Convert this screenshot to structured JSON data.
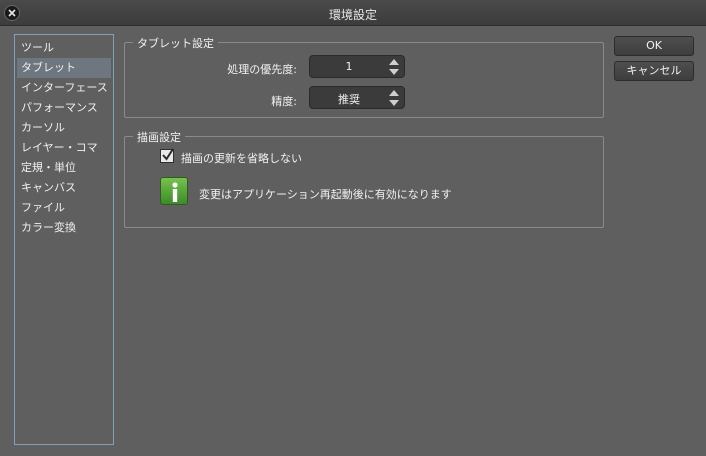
{
  "window": {
    "title": "環境設定"
  },
  "sidebar": {
    "items": [
      {
        "label": "ツール"
      },
      {
        "label": "タブレット",
        "selected": true
      },
      {
        "label": "インターフェース"
      },
      {
        "label": "パフォーマンス"
      },
      {
        "label": "カーソル"
      },
      {
        "label": "レイヤー・コマ"
      },
      {
        "label": "定規・単位"
      },
      {
        "label": "キャンバス"
      },
      {
        "label": "ファイル"
      },
      {
        "label": "カラー変換"
      }
    ]
  },
  "tablet_group": {
    "title": "タブレット設定",
    "processing_priority": {
      "label": "処理の優先度:",
      "value": "1"
    },
    "precision": {
      "label": "精度:",
      "value": "推奨"
    }
  },
  "drawing_group": {
    "title": "描画設定",
    "skip_updates": {
      "label": "描画の更新を省略しない",
      "checked": true
    },
    "info": {
      "icon": "info-icon",
      "text": "変更はアプリケーション再起動後に有効になります"
    }
  },
  "buttons": {
    "ok": "OK",
    "cancel": "キャンセル"
  },
  "colors": {
    "background": "#5f5f5f",
    "sidebar_border": "#7fa2b8",
    "info_icon": "#4fa53a"
  }
}
